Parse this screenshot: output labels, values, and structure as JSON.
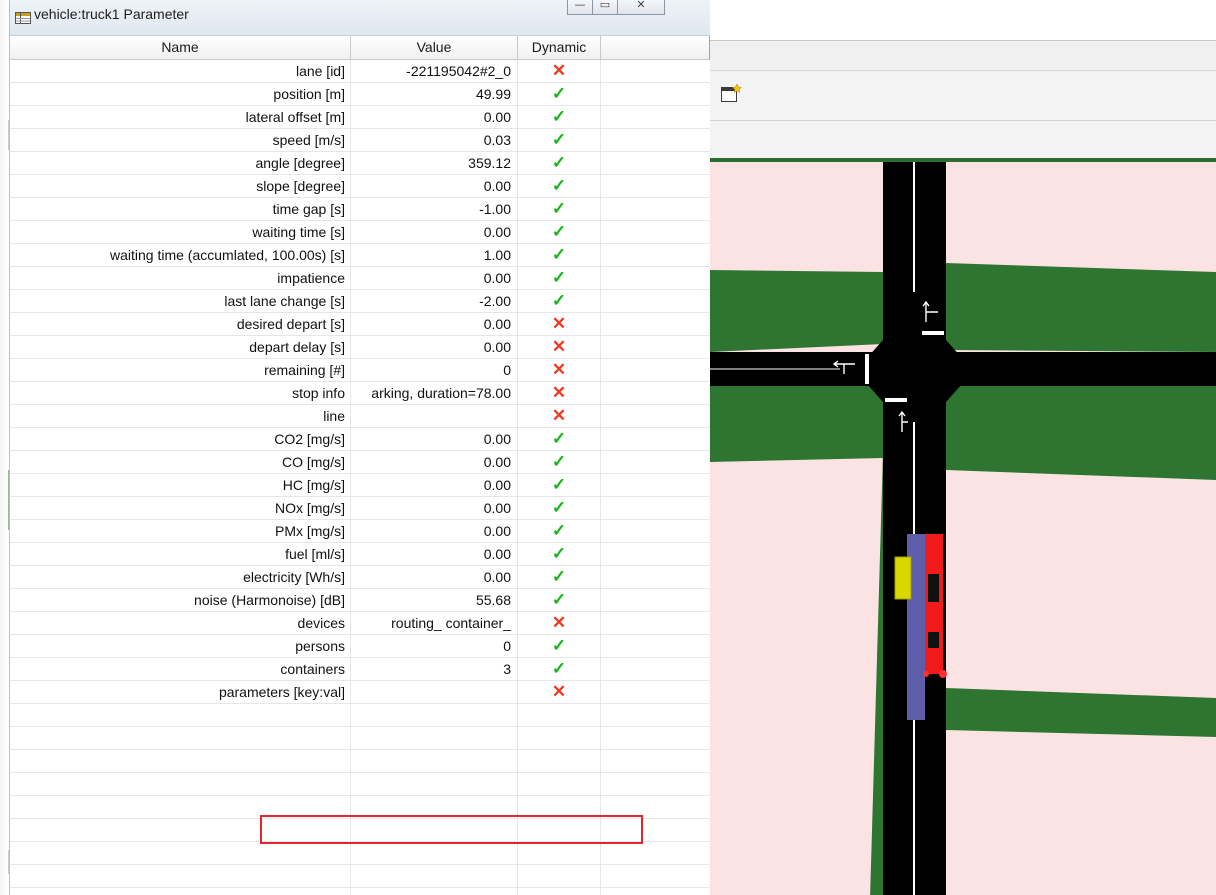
{
  "window": {
    "title": "vehicle:truck1 Parameter"
  },
  "window_buttons": [
    "—",
    "▭",
    "✕"
  ],
  "table": {
    "headers": [
      "Name",
      "Value",
      "Dynamic"
    ],
    "rows": [
      {
        "name": "lane [id]",
        "value": "-221195042#2_0",
        "dynamic": false
      },
      {
        "name": "position [m]",
        "value": "49.99",
        "dynamic": true
      },
      {
        "name": "lateral offset [m]",
        "value": "0.00",
        "dynamic": true
      },
      {
        "name": "speed [m/s]",
        "value": "0.03",
        "dynamic": true
      },
      {
        "name": "angle [degree]",
        "value": "359.12",
        "dynamic": true
      },
      {
        "name": "slope [degree]",
        "value": "0.00",
        "dynamic": true
      },
      {
        "name": "time gap [s]",
        "value": "-1.00",
        "dynamic": true
      },
      {
        "name": "waiting time [s]",
        "value": "0.00",
        "dynamic": true
      },
      {
        "name": "waiting time (accumlated, 100.00s) [s]",
        "value": "1.00",
        "dynamic": true
      },
      {
        "name": "impatience",
        "value": "0.00",
        "dynamic": true
      },
      {
        "name": "last lane change [s]",
        "value": "-2.00",
        "dynamic": true
      },
      {
        "name": "desired depart [s]",
        "value": "0.00",
        "dynamic": false
      },
      {
        "name": "depart delay [s]",
        "value": "0.00",
        "dynamic": false
      },
      {
        "name": "remaining [#]",
        "value": "0",
        "dynamic": false
      },
      {
        "name": "stop info",
        "value": "arking, duration=78.00",
        "dynamic": false
      },
      {
        "name": "line",
        "value": "",
        "dynamic": false
      },
      {
        "name": "CO2 [mg/s]",
        "value": "0.00",
        "dynamic": true
      },
      {
        "name": "CO [mg/s]",
        "value": "0.00",
        "dynamic": true
      },
      {
        "name": "HC [mg/s]",
        "value": "0.00",
        "dynamic": true
      },
      {
        "name": "NOx [mg/s]",
        "value": "0.00",
        "dynamic": true
      },
      {
        "name": "PMx [mg/s]",
        "value": "0.00",
        "dynamic": true
      },
      {
        "name": "fuel [ml/s]",
        "value": "0.00",
        "dynamic": true
      },
      {
        "name": "electricity [Wh/s]",
        "value": "0.00",
        "dynamic": true
      },
      {
        "name": "noise (Harmonoise) [dB]",
        "value": "55.68",
        "dynamic": true
      },
      {
        "name": "devices",
        "value": "routing_ container_",
        "dynamic": false
      },
      {
        "name": "persons",
        "value": "0",
        "dynamic": true
      },
      {
        "name": "containers",
        "value": "3",
        "dynamic": true,
        "highlighted": true
      },
      {
        "name": "parameters [key:val]",
        "value": "",
        "dynamic": false
      }
    ],
    "check_glyph": "✓",
    "cross_glyph": "✕"
  },
  "colors": {
    "check": "#18b518",
    "cross": "#ee3a20",
    "highlight_border": "#e2262b",
    "road": "#000000",
    "grass": "#2e7532",
    "background": "#fbe3e3",
    "vehicle_truck": "#f01a1a",
    "vehicle_container": "#5d5daa",
    "vehicle_yellow": "#d8d800"
  },
  "icons": {
    "title": "parameter-table-icon",
    "toolbar": "new-view-icon"
  }
}
